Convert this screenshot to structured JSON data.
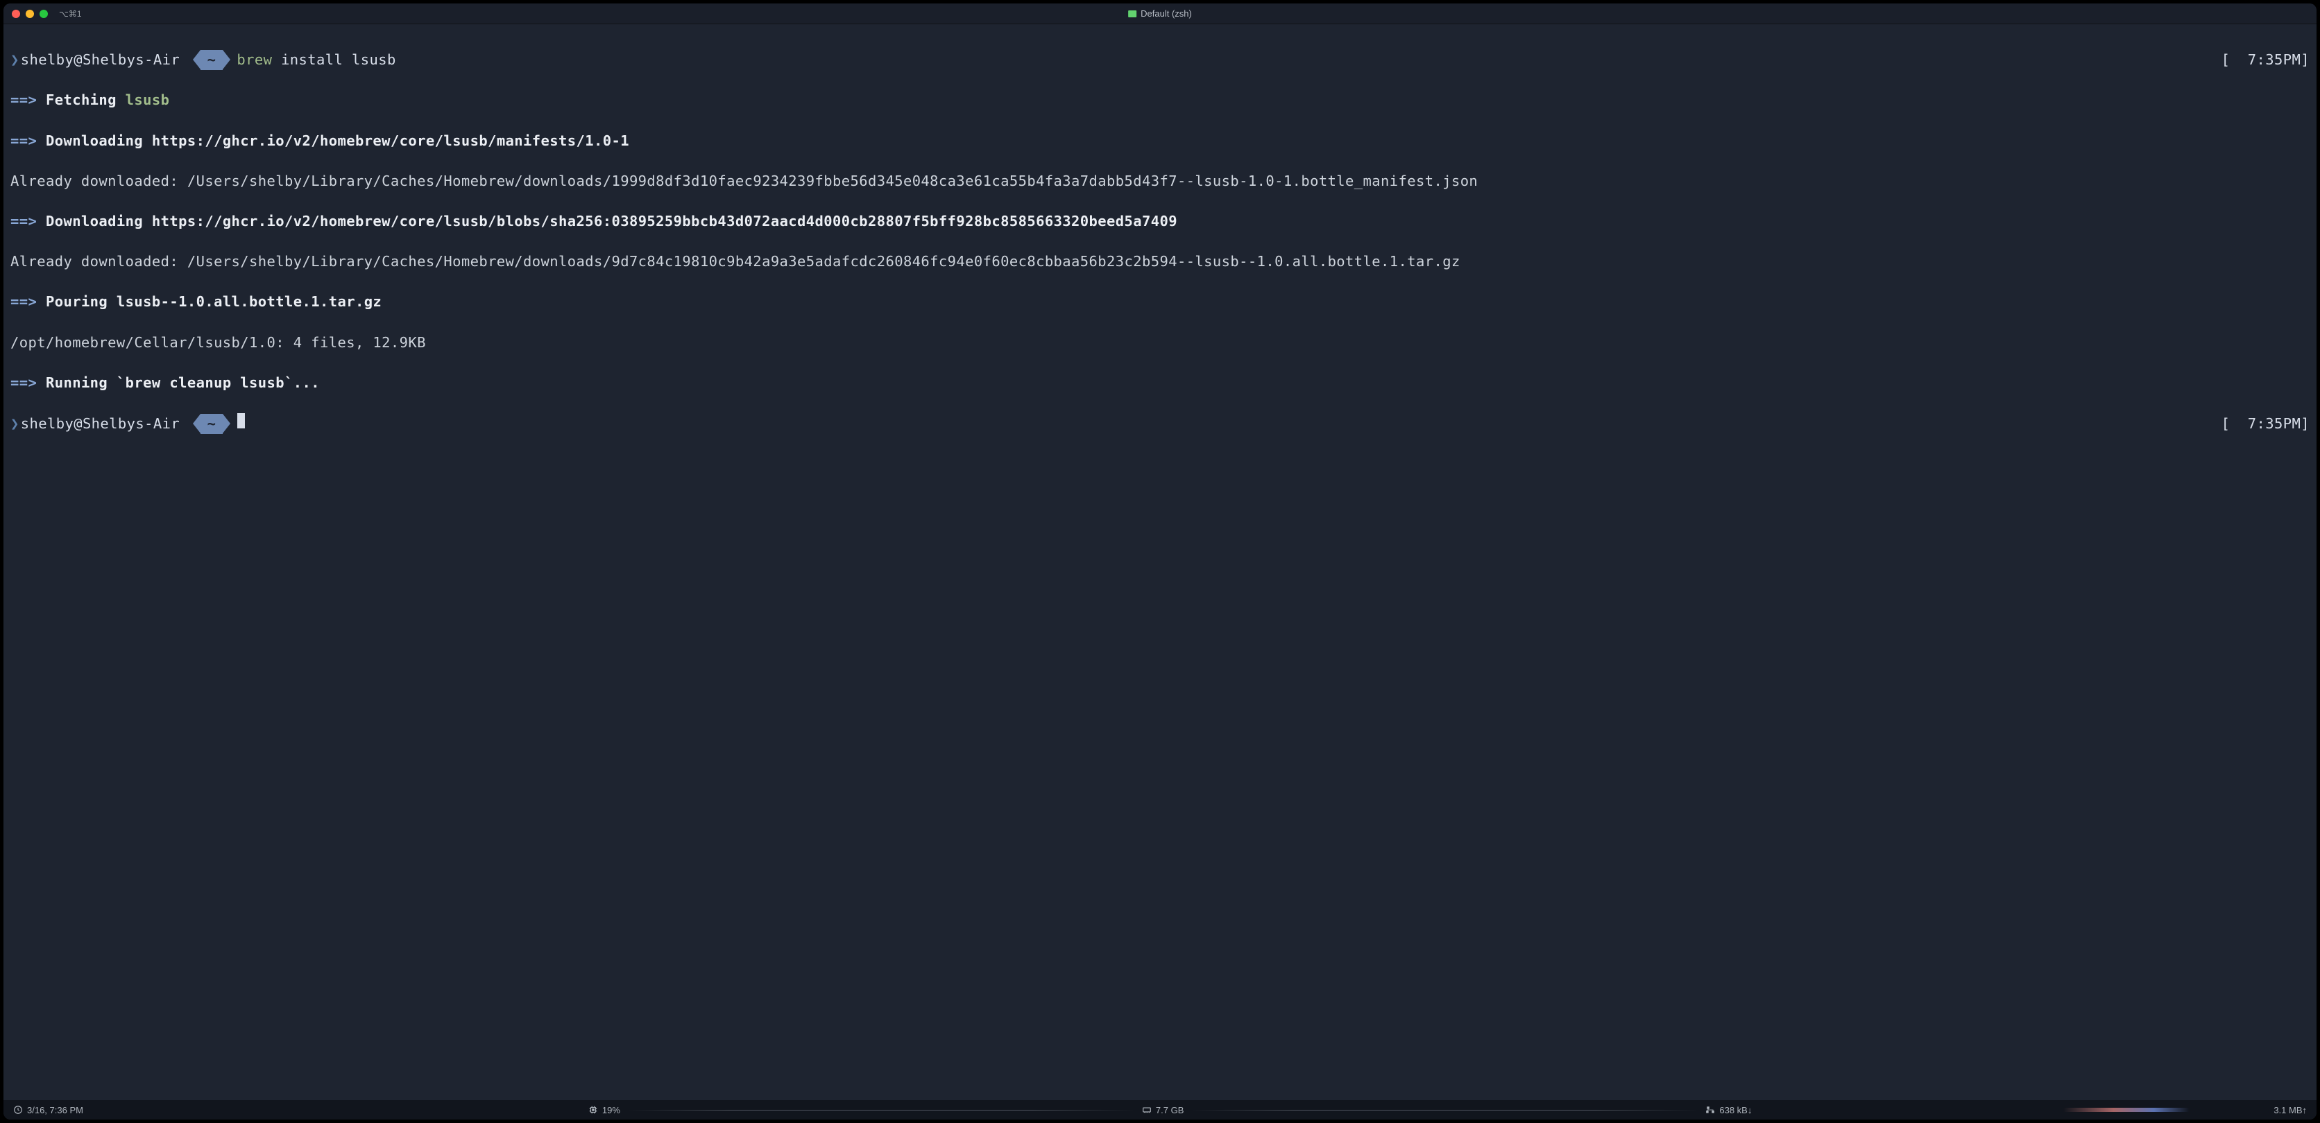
{
  "titlebar": {
    "tab_id": "⌥⌘1",
    "title": "Default (zsh)"
  },
  "prompt1": {
    "user": "shelby@Shelbys-Air",
    "dir": "~",
    "cmd_head": "brew",
    "cmd_rest": " install lsusb",
    "time": "[  7:35PM]"
  },
  "output": {
    "l1a": "==>",
    "l1b": " Fetching ",
    "l1c": "lsusb",
    "l2a": "==>",
    "l2b": " Downloading https://ghcr.io/v2/homebrew/core/lsusb/manifests/1.0-1",
    "l3": "Already downloaded: /Users/shelby/Library/Caches/Homebrew/downloads/1999d8df3d10faec9234239fbbe56d345e048ca3e61ca55b4fa3a7dabb5d43f7--lsusb-1.0-1.bottle_manifest.json",
    "l4a": "==>",
    "l4b": " Downloading https://ghcr.io/v2/homebrew/core/lsusb/blobs/sha256:03895259bbcb43d072aacd4d000cb28807f5bff928bc8585663320beed5a7409",
    "l5": "Already downloaded: /Users/shelby/Library/Caches/Homebrew/downloads/9d7c84c19810c9b42a9a3e5adafcdc260846fc94e0f60ec8cbbaa56b23c2b594--lsusb--1.0.all.bottle.1.tar.gz",
    "l6a": "==>",
    "l6b": " Pouring lsusb--1.0.all.bottle.1.tar.gz",
    "l7": "/opt/homebrew/Cellar/lsusb/1.0: 4 files, 12.9KB",
    "l8a": "==>",
    "l8b": " Running `brew cleanup lsusb`..."
  },
  "prompt2": {
    "user": "shelby@Shelbys-Air",
    "dir": "~",
    "time": "[  7:35PM]"
  },
  "statusbar": {
    "clock": "3/16, 7:36 PM",
    "cpu": "19%",
    "ram": "7.7 GB",
    "net_down": "638 kB↓",
    "net_up": "3.1 MB↑"
  }
}
